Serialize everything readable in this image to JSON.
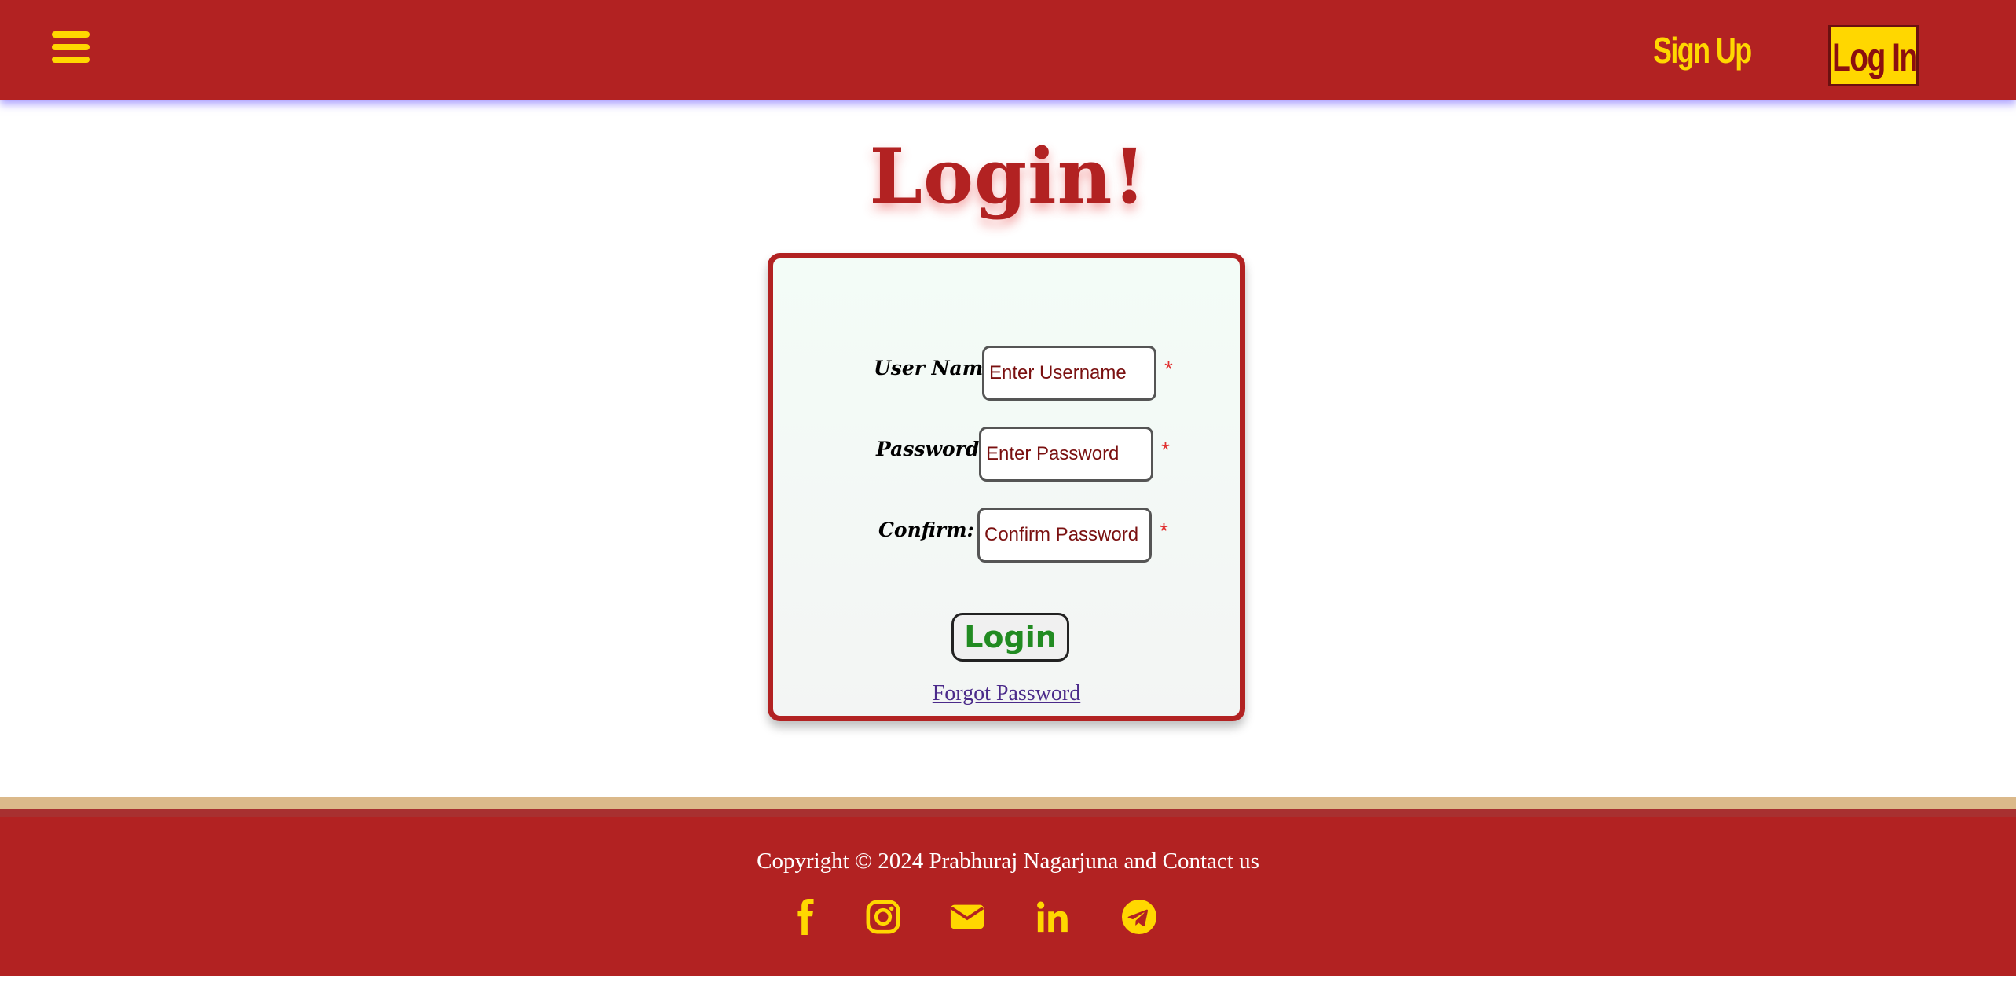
{
  "header": {
    "menu_icon": "hamburger-menu-icon",
    "signup_label": "Sign Up",
    "login_label": "Log In"
  },
  "page": {
    "title": "Login!"
  },
  "form": {
    "username": {
      "label": "User Name:",
      "placeholder": "Enter Username",
      "required_mark": "*"
    },
    "password": {
      "label": "Password:",
      "placeholder": "Enter Password",
      "required_mark": "*"
    },
    "confirm": {
      "label": "Confirm:",
      "placeholder": "Confirm Password",
      "required_mark": "*"
    },
    "submit_label": "Login",
    "forgot_label": "Forgot Password"
  },
  "footer": {
    "copyright": "Copyright © 2024 Prabhuraj Nagarjuna and Contact us",
    "social_icons": [
      "facebook-icon",
      "instagram-icon",
      "email-icon",
      "linkedin-icon",
      "telegram-icon"
    ]
  },
  "colors": {
    "brand_red": "#b22222",
    "accent_yellow": "#ffd700",
    "button_green": "#228b22",
    "footer_stripe": "#dbb98a"
  }
}
